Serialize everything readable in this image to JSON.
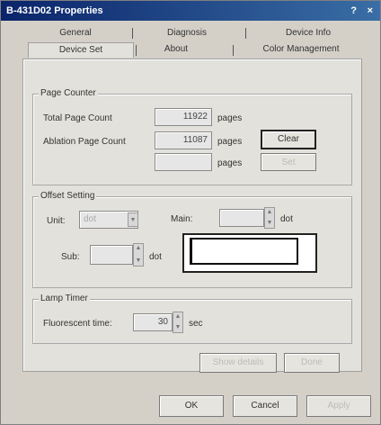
{
  "window": {
    "title": "B-431D02 Properties",
    "help_glyph": "?",
    "close_glyph": "×"
  },
  "tabs": {
    "row1": [
      "General",
      "Diagnosis",
      "Device Info"
    ],
    "row2": [
      "Device Set",
      "About",
      "Color Management"
    ]
  },
  "page_counter": {
    "title": "Page Counter",
    "total_label": "Total Page Count",
    "total_value": "11922",
    "ablation_label": "Ablation Page Count",
    "ablation_value": "11087",
    "third_value": "",
    "unit": "pages",
    "clear_button": "Clear",
    "disabled_button": "Set"
  },
  "offset_setting": {
    "title": "Offset Setting",
    "unit_label": "Unit:",
    "unit_value": "dot",
    "main_label": "Main:",
    "main_value": "",
    "main_unit": "dot",
    "sub_label": "Sub:",
    "sub_value": "",
    "sub_unit": "dot"
  },
  "lamp_timer": {
    "title": "Lamp Timer",
    "fluorescent_label": "Fluorescent time:",
    "fluorescent_value": "30",
    "unit": "sec"
  },
  "panel_buttons": {
    "left": "Show details",
    "right": "Done"
  },
  "dialog_buttons": {
    "ok": "OK",
    "cancel": "Cancel",
    "apply": "Apply"
  }
}
